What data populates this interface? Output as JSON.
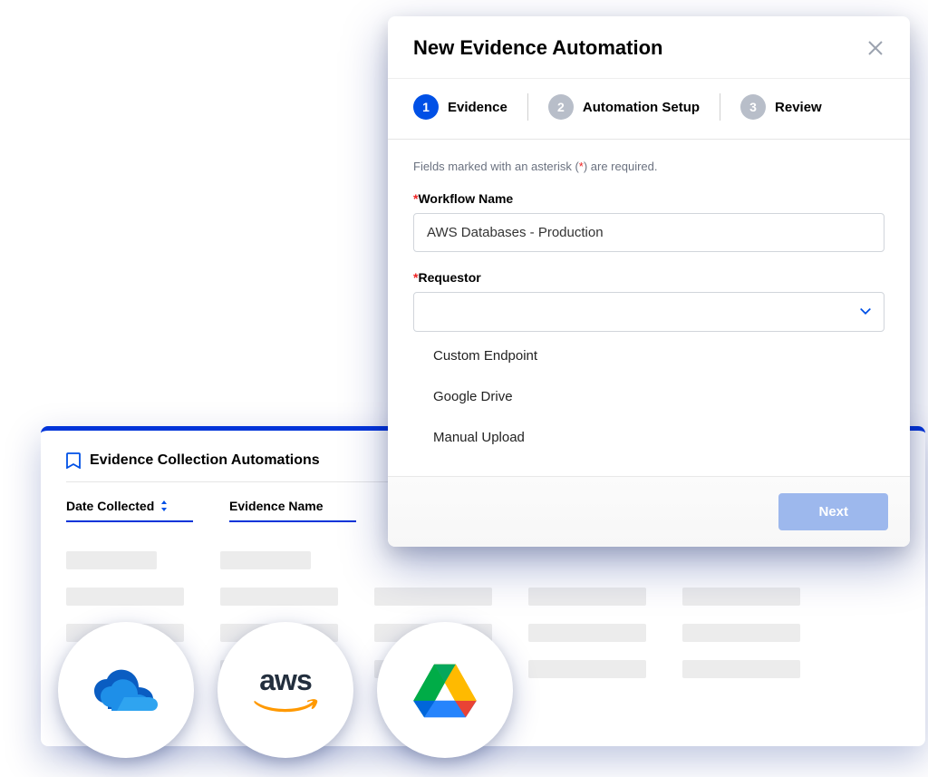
{
  "bgPanel": {
    "title": "Evidence Collection Automations",
    "columns": [
      {
        "label": "Date Collected"
      },
      {
        "label": "Evidence Name"
      }
    ]
  },
  "modal": {
    "title": "New Evidence Automation",
    "steps": [
      {
        "num": "1",
        "label": "Evidence",
        "active": true
      },
      {
        "num": "2",
        "label": "Automation Setup",
        "active": false
      },
      {
        "num": "3",
        "label": "Review",
        "active": false
      }
    ],
    "requiredNote": "Fields marked with an asterisk (",
    "requiredAst": "*",
    "requiredNoteEnd": ") are required.",
    "workflowLabel": "Workflow Name",
    "workflowValue": "AWS Databases - Production",
    "requestorLabel": "Requestor",
    "requestorOptions": [
      "Custom Endpoint",
      "Google Drive",
      "Manual Upload"
    ],
    "nextLabel": "Next"
  },
  "logos": [
    {
      "name": "onedrive"
    },
    {
      "name": "aws"
    },
    {
      "name": "google-drive"
    }
  ]
}
